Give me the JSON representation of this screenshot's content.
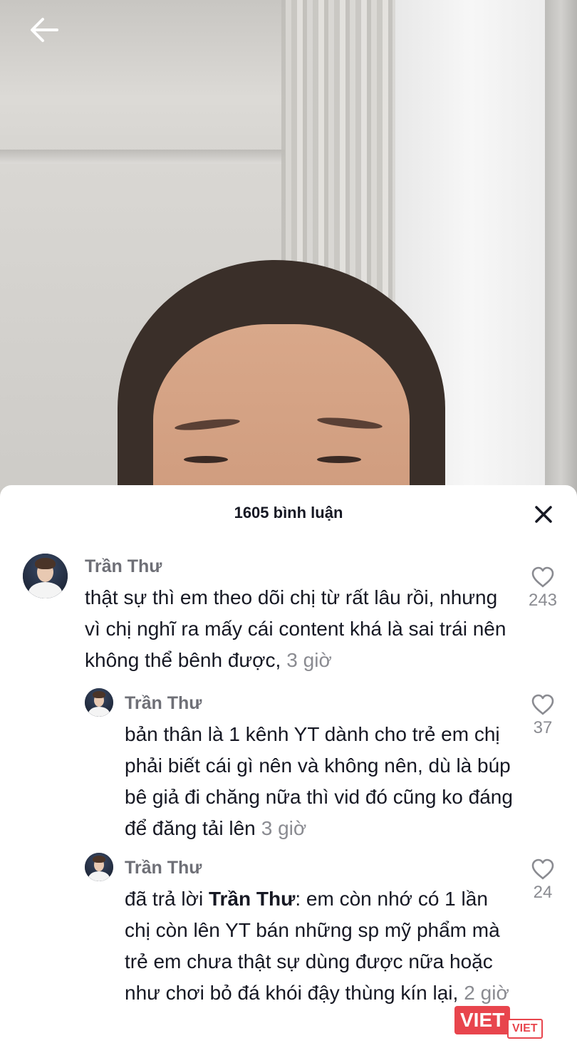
{
  "header": {
    "back_icon": "arrow-left-icon"
  },
  "sheet": {
    "title": "1605 bình luận",
    "close_icon": "close-icon"
  },
  "comments": [
    {
      "username": "Trần Thư",
      "text": "thật sự thì em theo dõi chị từ rất lâu rồi, nhưng vì chị nghĩ ra mấy cái content khá là sai trái nên không thể bênh được,",
      "time": "3 giờ",
      "likes": "243",
      "like_icon": "heart-icon"
    },
    {
      "username": "Trần Thư",
      "text": "bản thân là 1 kênh YT dành cho trẻ em chị phải biết cái gì nên và không nên, dù là búp bê giả đi chăng nữa thì vid đó cũng ko đáng để đăng tải lên",
      "time": "3 giờ",
      "likes": "37",
      "like_icon": "heart-icon"
    },
    {
      "username": "Trần Thư",
      "reply_prefix": "đã trả lời ",
      "reply_to": "Trần Thư",
      "text": ": em còn nhớ có 1 lần chị còn lên YT bán những sp mỹ phẩm mà trẻ em chưa thật sự dùng được nữa hoặc như chơi bỏ đá khói đậy thùng kín lại,",
      "time": "2 giờ",
      "likes": "24",
      "like_icon": "heart-icon"
    }
  ],
  "watermark": {
    "main": "VIET",
    "sub": "VIET"
  }
}
